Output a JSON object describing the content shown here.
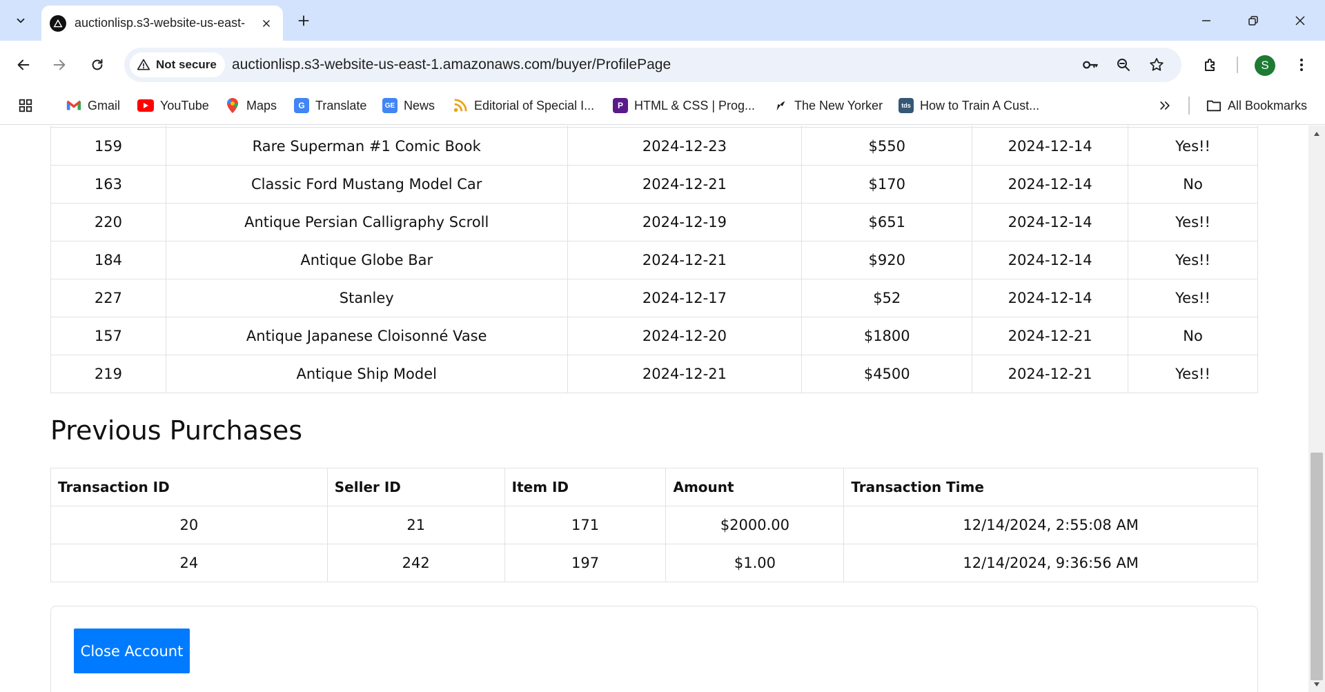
{
  "browser": {
    "tab_title": "auctionlisp.s3-website-us-east-",
    "security_label": "Not secure",
    "url": "auctionlisp.s3-website-us-east-1.amazonaws.com/buyer/ProfilePage",
    "profile_initial": "S",
    "bookmarks": [
      {
        "label": "Gmail",
        "icon": "gmail-icon"
      },
      {
        "label": "YouTube",
        "icon": "youtube-icon"
      },
      {
        "label": "Maps",
        "icon": "maps-icon"
      },
      {
        "label": "Translate",
        "icon": "translate-icon"
      },
      {
        "label": "News",
        "icon": "news-icon"
      },
      {
        "label": "Editorial of Special I...",
        "icon": "rss-icon"
      },
      {
        "label": "HTML & CSS | Prog...",
        "icon": "p-icon"
      },
      {
        "label": "The New Yorker",
        "icon": "new-yorker-icon"
      },
      {
        "label": "How to Train A Cust...",
        "icon": "tds-icon"
      }
    ],
    "all_bookmarks_label": "All Bookmarks"
  },
  "bids_table": {
    "rows": [
      [
        "159",
        "Rare Superman #1 Comic Book",
        "2024-12-23",
        "$550",
        "2024-12-14",
        "Yes!!"
      ],
      [
        "163",
        "Classic Ford Mustang Model Car",
        "2024-12-21",
        "$170",
        "2024-12-14",
        "No"
      ],
      [
        "220",
        "Antique Persian Calligraphy Scroll",
        "2024-12-19",
        "$651",
        "2024-12-14",
        "Yes!!"
      ],
      [
        "184",
        "Antique Globe Bar",
        "2024-12-21",
        "$920",
        "2024-12-14",
        "Yes!!"
      ],
      [
        "227",
        "Stanley",
        "2024-12-17",
        "$52",
        "2024-12-14",
        "Yes!!"
      ],
      [
        "157",
        "Antique Japanese Cloisonné Vase",
        "2024-12-20",
        "$1800",
        "2024-12-21",
        "No"
      ],
      [
        "219",
        "Antique Ship Model",
        "2024-12-21",
        "$4500",
        "2024-12-21",
        "Yes!!"
      ]
    ]
  },
  "purchases": {
    "title": "Previous Purchases",
    "headers": [
      "Transaction ID",
      "Seller ID",
      "Item ID",
      "Amount",
      "Transaction Time"
    ],
    "rows": [
      [
        "20",
        "21",
        "171",
        "$2000.00",
        "12/14/2024, 2:55:08 AM"
      ],
      [
        "24",
        "242",
        "197",
        "$1.00",
        "12/14/2024, 9:36:56 AM"
      ]
    ]
  },
  "close_account_label": "Close Account"
}
